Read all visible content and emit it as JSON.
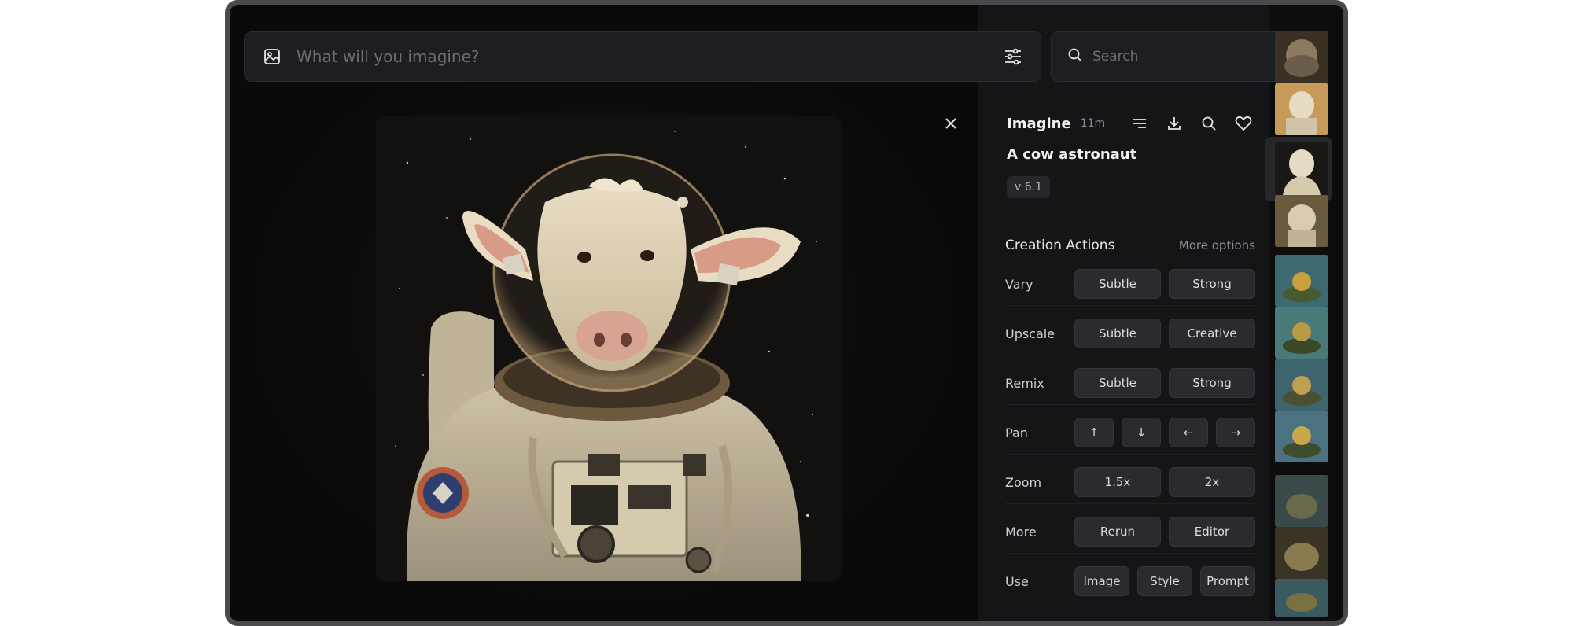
{
  "prompt_bar": {
    "placeholder": "What will you imagine?"
  },
  "search": {
    "placeholder": "Search"
  },
  "job": {
    "title": "Imagine",
    "time": "11m",
    "prompt": "A cow astronaut",
    "version": "v 6.1"
  },
  "icons": {
    "image": "image-icon",
    "settings": "sliders-icon",
    "search": "search-icon",
    "close": "close-icon",
    "menu": "menu-icon",
    "download": "download-icon",
    "zoom": "search-icon",
    "like": "heart-icon"
  },
  "creation": {
    "title": "Creation Actions",
    "more_options": "More options",
    "rows": [
      {
        "label": "Vary",
        "buttons": [
          "Subtle",
          "Strong"
        ]
      },
      {
        "label": "Upscale",
        "buttons": [
          "Subtle",
          "Creative"
        ]
      },
      {
        "label": "Remix",
        "buttons": [
          "Subtle",
          "Strong"
        ]
      },
      {
        "label": "Pan",
        "buttons": [
          "↑",
          "↓",
          "←",
          "→"
        ]
      },
      {
        "label": "Zoom",
        "buttons": [
          "1.5x",
          "2x"
        ]
      },
      {
        "label": "More",
        "buttons": [
          "Rerun",
          "Editor"
        ]
      },
      {
        "label": "Use",
        "buttons": [
          "Image",
          "Style",
          "Prompt"
        ]
      }
    ]
  },
  "colors": {
    "background": "#0d0d0e",
    "panel": "#151517",
    "button": "#2a2b2f",
    "text": "#f0f0f2"
  }
}
